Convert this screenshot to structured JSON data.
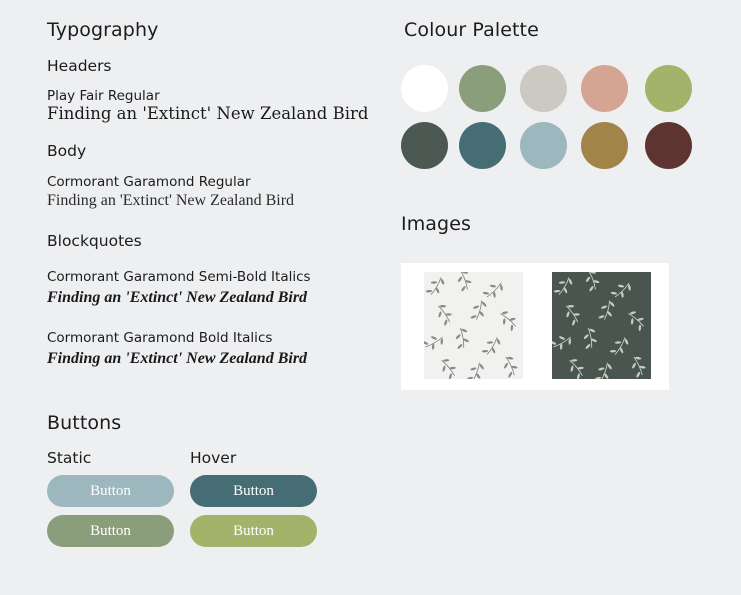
{
  "typography": {
    "title": "Typography",
    "headers": {
      "heading": "Headers",
      "font_name": "Play Fair Regular",
      "sample": "Finding an 'Extinct' New Zealand Bird"
    },
    "body": {
      "heading": "Body",
      "font_name": "Cormorant Garamond Regular",
      "sample": "Finding an 'Extinct' New Zealand Bird"
    },
    "blockquotes": {
      "heading": "Blockquotes",
      "items": [
        {
          "font_name": "Cormorant Garamond Semi-Bold Italics",
          "sample": "Finding an 'Extinct' New Zealand Bird"
        },
        {
          "font_name": "Cormorant Garamond Bold Italics",
          "sample": "Finding an 'Extinct' New Zealand Bird"
        }
      ]
    }
  },
  "palette": {
    "title": "Colour Palette",
    "colors": [
      "#ffffff",
      "#8a9e7c",
      "#ccc9c3",
      "#d4a592",
      "#a3b36a",
      "#4c5852",
      "#466c74",
      "#9cb7bd",
      "#a38448",
      "#5e3431"
    ]
  },
  "images": {
    "title": "Images",
    "items": [
      {
        "name": "light-leaf-pattern",
        "bg": "#f1f1ef",
        "leaf": "#7d7d7d"
      },
      {
        "name": "dark-leaf-pattern",
        "bg": "#4a554f",
        "leaf": "#d7dcd7"
      }
    ]
  },
  "buttons": {
    "title": "Buttons",
    "static_label": "Static",
    "hover_label": "Hover",
    "static": [
      {
        "label": "Button",
        "color": "#9cb7bd"
      },
      {
        "label": "Button",
        "color": "#8a9e7c"
      }
    ],
    "hover": [
      {
        "label": "Button",
        "color": "#466c74"
      },
      {
        "label": "Button",
        "color": "#a3b36a"
      }
    ]
  }
}
